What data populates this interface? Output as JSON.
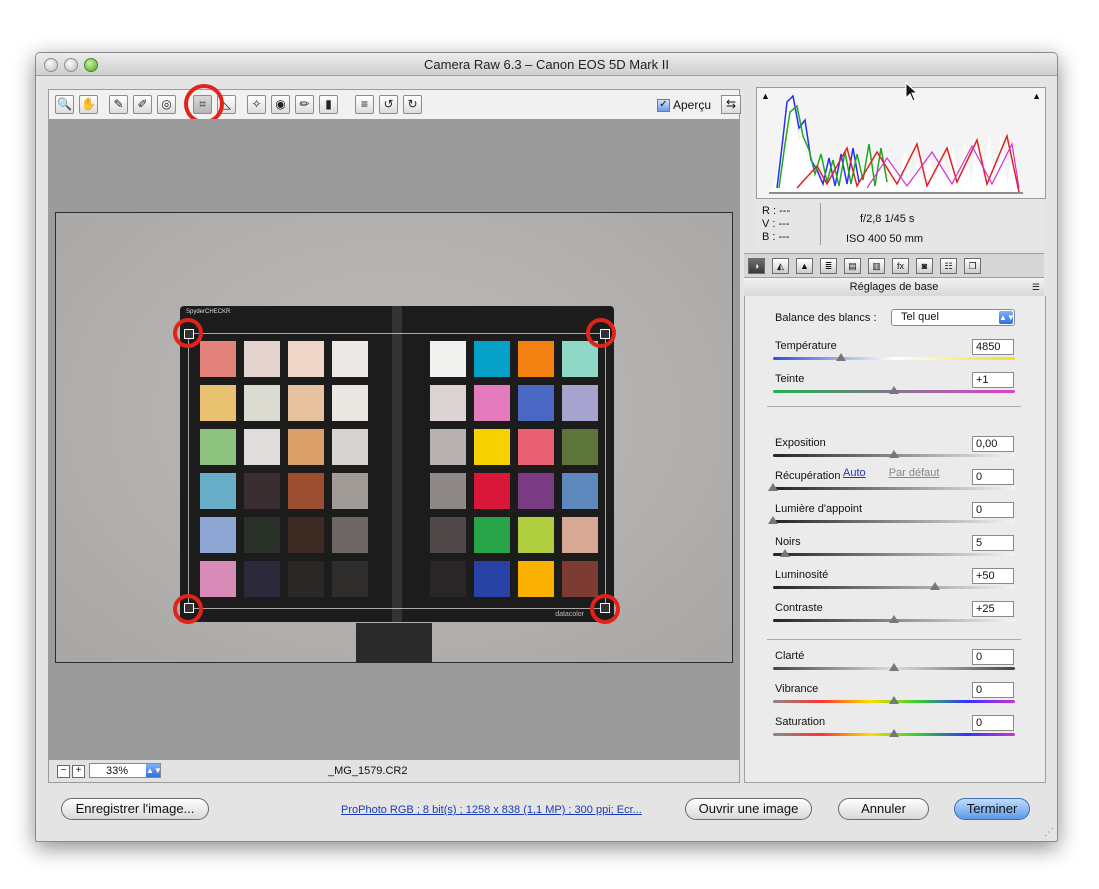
{
  "window": {
    "title": "Camera Raw 6.3  –  Canon EOS 5D Mark II"
  },
  "toolbar": {
    "tools": [
      {
        "name": "zoom-tool-icon",
        "glyph": "🔍"
      },
      {
        "name": "hand-tool-icon",
        "glyph": "✋"
      },
      {
        "name": "white-balance-tool-icon",
        "glyph": "✎"
      },
      {
        "name": "color-sampler-tool-icon",
        "glyph": "✐"
      },
      {
        "name": "targeted-adjustment-tool-icon",
        "glyph": "◎"
      },
      {
        "name": "crop-tool-icon",
        "glyph": "⌗"
      },
      {
        "name": "straighten-tool-icon",
        "glyph": "◺"
      },
      {
        "name": "spot-removal-tool-icon",
        "glyph": "✧"
      },
      {
        "name": "red-eye-tool-icon",
        "glyph": "◉"
      },
      {
        "name": "adjustment-brush-icon",
        "glyph": "✏"
      },
      {
        "name": "graduated-filter-icon",
        "glyph": "▮"
      },
      {
        "name": "preferences-icon",
        "glyph": "≡"
      },
      {
        "name": "rotate-ccw-icon",
        "glyph": "↺"
      },
      {
        "name": "rotate-cw-icon",
        "glyph": "↻"
      }
    ],
    "preview_label": "Aperçu",
    "preview_checked": true
  },
  "bottom": {
    "minus": "−",
    "plus": "+",
    "zoom": "33%",
    "filename": "_MG_1579.CR2"
  },
  "histogram": {
    "rgb": [
      "R :  ---",
      "V :  ---",
      "B :  ---"
    ],
    "aperture_shutter": "f/2,8   1/45 s",
    "iso_focal": "ISO 400   50 mm"
  },
  "panel": {
    "tabs": [
      "◑",
      "◭",
      "▲",
      "≣",
      "▤",
      "▥",
      "fx",
      "◙",
      "☷",
      "❐"
    ],
    "title": "Réglages de base",
    "wb_label": "Balance des blancs :",
    "wb_value": "Tel quel",
    "auto": "Auto",
    "default": "Par défaut",
    "sliders": [
      {
        "label": "Température",
        "value": "4850",
        "pos": 0.28
      },
      {
        "label": "Teinte",
        "value": "+1",
        "pos": 0.5
      },
      {
        "label": "Exposition",
        "value": "0,00",
        "pos": 0.5
      },
      {
        "label": "Récupération",
        "value": "0",
        "pos": 0.0
      },
      {
        "label": "Lumière d'appoint",
        "value": "0",
        "pos": 0.0
      },
      {
        "label": "Noirs",
        "value": "5",
        "pos": 0.05
      },
      {
        "label": "Luminosité",
        "value": "+50",
        "pos": 0.67
      },
      {
        "label": "Contraste",
        "value": "+25",
        "pos": 0.5
      },
      {
        "label": "Clarté",
        "value": "0",
        "pos": 0.5
      },
      {
        "label": "Vibrance",
        "value": "0",
        "pos": 0.5
      },
      {
        "label": "Saturation",
        "value": "0",
        "pos": 0.5
      }
    ]
  },
  "footer": {
    "save": "Enregistrer l'image...",
    "workflow": "ProPhoto RGB ; 8 bit(s) ; 1258 x 838 (1,1 MP) ; 300 ppi; Ecr...",
    "open": "Ouvrir une image",
    "cancel": "Annuler",
    "done": "Terminer"
  },
  "checker": {
    "brand": "SpyderCHECKR",
    "brand2": "datacolor",
    "left_columns": [
      [
        "#e2827a",
        "#e4d3cf",
        "#efd6c8",
        "#ebe8e5"
      ],
      [
        "#e8c271",
        "#dcdbd2",
        "#e6c2a1",
        "#eae6e2"
      ],
      [
        "#8ec27f",
        "#e0dcdc",
        "#d9a069",
        "#d6d3d1"
      ],
      [
        "#69aec9",
        "#3a2e31",
        "#9d4d30",
        "#a19b97"
      ],
      [
        "#8ea6d3",
        "#2a3129",
        "#3d2a23",
        "#6d6664"
      ],
      [
        "#d88bb6",
        "#2c293b",
        "#2a2725",
        "#2f2d2c"
      ]
    ],
    "right_columns": [
      [
        "#f1f1ef",
        "#05a0c8",
        "#f48212",
        "#8fd8c6"
      ],
      [
        "#dcd3d3",
        "#e47bbc",
        "#4b67c4",
        "#a6a3cf"
      ],
      [
        "#b7b2b1",
        "#f7d100",
        "#eb5f72",
        "#5d7538"
      ],
      [
        "#8e8987",
        "#d8173a",
        "#7a3b83",
        "#5f88bd"
      ],
      [
        "#4e4848",
        "#27a44a",
        "#b0ce3e",
        "#d9a894"
      ],
      [
        "#2a2627",
        "#2842a6",
        "#f9b000",
        "#7c3c34"
      ]
    ]
  }
}
